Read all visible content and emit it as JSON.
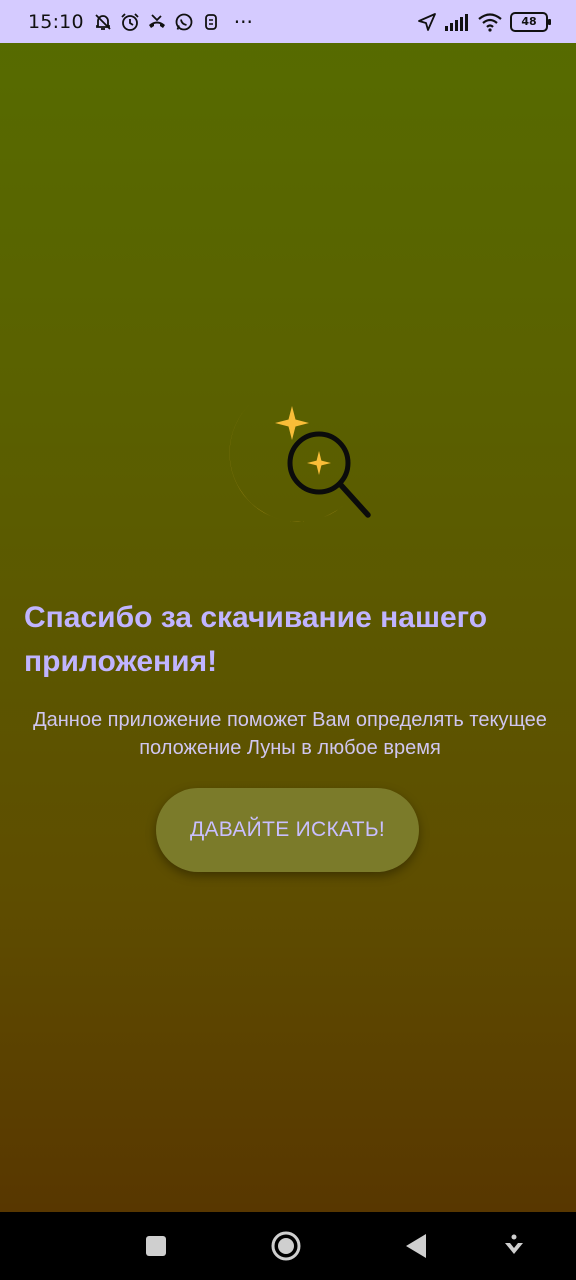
{
  "status_bar": {
    "time": "15:10",
    "icons_left": [
      "bell-off-icon",
      "alarm-icon",
      "missed-call-icon",
      "whatsapp-icon",
      "sim-icon",
      "more-icon"
    ],
    "more": "···",
    "icons_right": [
      "location-icon",
      "signal-icon",
      "wifi-icon",
      "battery-icon"
    ],
    "battery": "48"
  },
  "main": {
    "logo": "moon-search-logo",
    "title": "Спасибо за скачивание нашего приложения!",
    "description": "Данное приложение поможет Вам определять текущее положение Луны в любое время",
    "cta_label": "ДАВАЙТЕ ИСКАТЬ!"
  },
  "nav_bar": {
    "buttons": [
      "recents-square-icon",
      "home-circle-icon",
      "back-triangle-icon",
      "assist-down-icon"
    ]
  },
  "colors": {
    "status_bg": "#d5cbff",
    "title": "#c0b4ff",
    "button_bg": "#7b7b2a",
    "moon": "#f9bd38"
  }
}
